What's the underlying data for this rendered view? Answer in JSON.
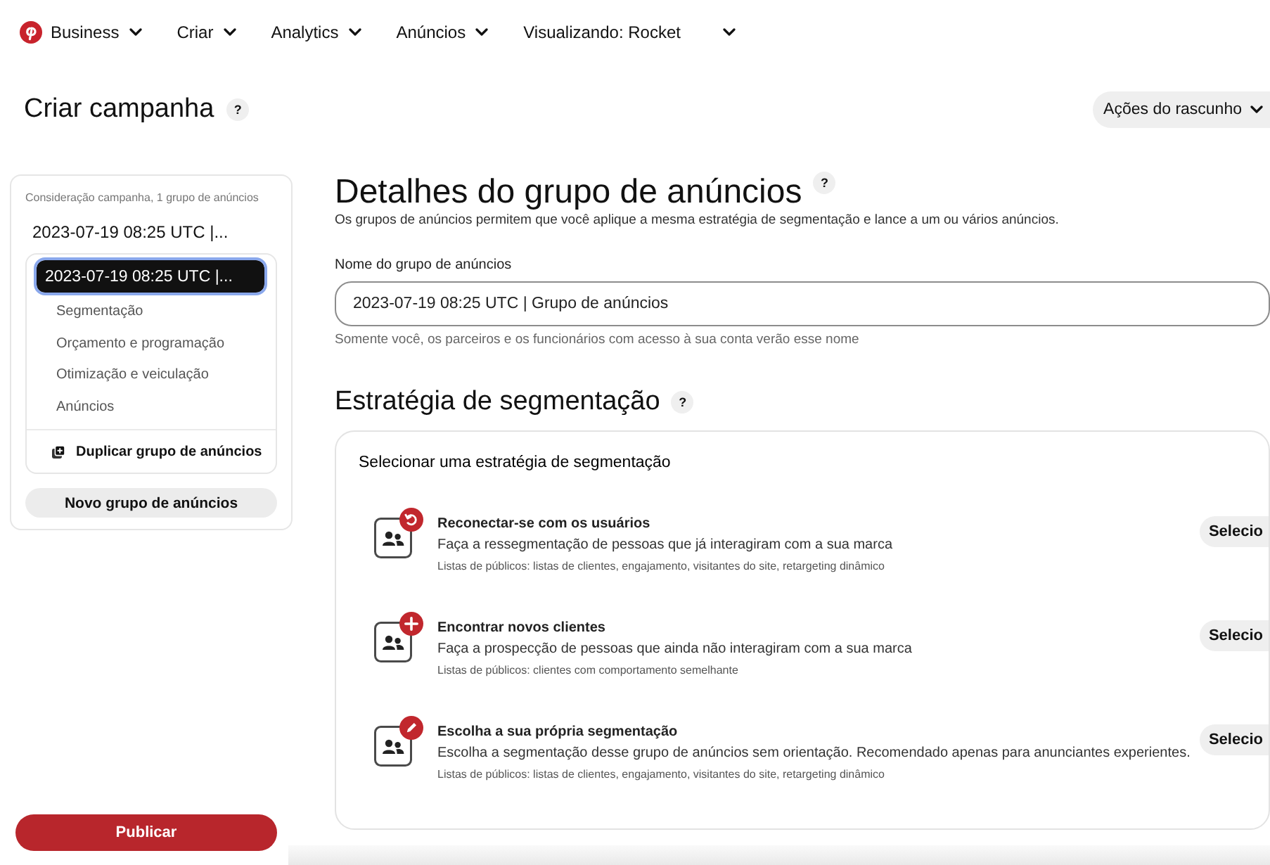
{
  "top_nav": {
    "items": [
      {
        "label": "Business",
        "kind": "menu"
      },
      {
        "label": "Criar",
        "kind": "menu"
      },
      {
        "label": "Analytics",
        "kind": "menu"
      },
      {
        "label": "Anúncios",
        "kind": "menu"
      },
      {
        "label": "Visualizando: Rocket",
        "kind": "account"
      }
    ]
  },
  "header": {
    "title": "Criar campanha",
    "help": "?",
    "draft_actions": "Ações do rascunho"
  },
  "sidebar": {
    "caption": "Consideração campanha, 1 grupo de anúncios",
    "campaign": {
      "label": "2023-07-19 08:25 UTC |...",
      "selected": false
    },
    "ad_group": {
      "label": "2023-07-19 08:25 UTC |...",
      "selected": true,
      "sections": [
        {
          "label": "Segmentação",
          "selected": false
        },
        {
          "label": "Orçamento e programação",
          "selected": false
        },
        {
          "label": "Otimização e veiculação",
          "selected": false
        },
        {
          "label": "Anúncios",
          "selected": false
        }
      ]
    },
    "duplicate": "Duplicar grupo de anúncios",
    "new_group": "Novo grupo de anúncios",
    "publish": "Publicar"
  },
  "details": {
    "title": "Detalhes do grupo de anúncios",
    "help": "?",
    "description": "Os grupos de anúncios permitem que você aplique a mesma estratégia de segmentação e lance a um ou vários anúncios.",
    "name_field": {
      "label": "Nome do grupo de anúncios",
      "value": "2023-07-19 08:25 UTC | Grupo de anúncios",
      "helper": "Somente você, os parceiros e os funcionários com acesso à sua conta verão esse nome"
    }
  },
  "strategy": {
    "title": "Estratégia de segmentação",
    "help": "?",
    "card_title": "Selecionar uma estratégia de segmentação",
    "options": [
      {
        "kind": "reconnect",
        "title": "Reconectar-se com os usuários",
        "description": "Faça a ressegmentação de pessoas que já interagiram com a sua marca",
        "audiences": "Listas de públicos: listas de clientes, engajamento, visitantes do site, retargeting dinâmico",
        "button": "Selecio"
      },
      {
        "kind": "new",
        "title": "Encontrar novos clientes",
        "description": "Faça a prospecção de pessoas que ainda não interagiram com a sua marca",
        "audiences": "Listas de públicos: clientes com comportamento semelhante",
        "button": "Selecio"
      },
      {
        "kind": "custom",
        "title": "Escolha a sua própria segmentação",
        "description": "Escolha a segmentação desse grupo de anúncios sem orientação. Recomendado apenas para anunciantes experientes.",
        "audiences": "Listas de públicos: listas de clientes, engajamento, visitantes do site, retargeting dinâmico",
        "button": "Selecio"
      }
    ]
  }
}
